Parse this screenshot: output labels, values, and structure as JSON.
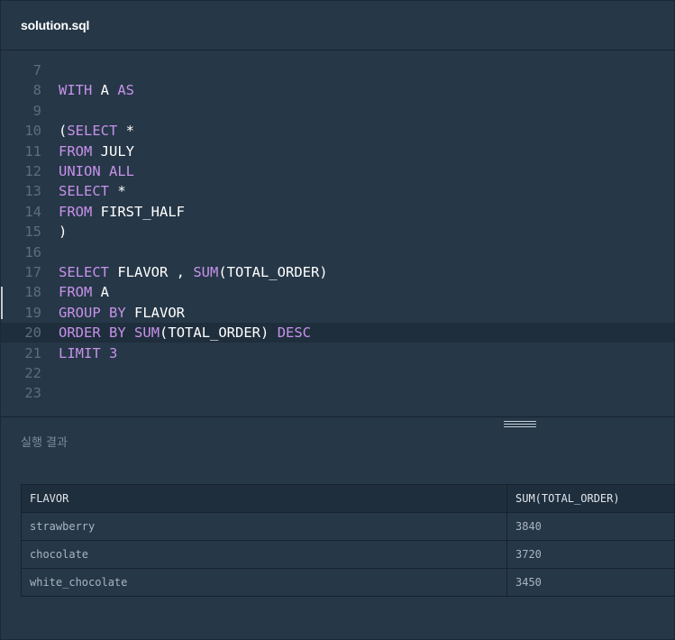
{
  "tab": {
    "title": "solution.sql"
  },
  "editor": {
    "lines": [
      {
        "n": "7",
        "tokens": []
      },
      {
        "n": "8",
        "tokens": [
          [
            "kw",
            "WITH"
          ],
          [
            "t",
            " A "
          ],
          [
            "kw",
            "AS"
          ]
        ]
      },
      {
        "n": "9",
        "tokens": []
      },
      {
        "n": "10",
        "tokens": [
          [
            "t",
            "("
          ],
          [
            "kw",
            "SELECT"
          ],
          [
            "t",
            " *"
          ]
        ]
      },
      {
        "n": "11",
        "tokens": [
          [
            "kw",
            "FROM"
          ],
          [
            "t",
            " JULY"
          ]
        ]
      },
      {
        "n": "12",
        "tokens": [
          [
            "kw",
            "UNION"
          ],
          [
            "t",
            " "
          ],
          [
            "kw",
            "ALL"
          ]
        ]
      },
      {
        "n": "13",
        "tokens": [
          [
            "kw",
            "SELECT"
          ],
          [
            "t",
            " *"
          ]
        ]
      },
      {
        "n": "14",
        "tokens": [
          [
            "kw",
            "FROM"
          ],
          [
            "t",
            " FIRST_HALF"
          ]
        ]
      },
      {
        "n": "15",
        "tokens": [
          [
            "t",
            ")"
          ]
        ]
      },
      {
        "n": "16",
        "tokens": []
      },
      {
        "n": "17",
        "tokens": [
          [
            "kw",
            "SELECT"
          ],
          [
            "t",
            " FLAVOR , "
          ],
          [
            "kw",
            "SUM"
          ],
          [
            "t",
            "(TOTAL_ORDER)"
          ]
        ]
      },
      {
        "n": "18",
        "tokens": [
          [
            "kw",
            "FROM"
          ],
          [
            "t",
            " A"
          ]
        ]
      },
      {
        "n": "19",
        "tokens": [
          [
            "kw",
            "GROUP"
          ],
          [
            "t",
            " "
          ],
          [
            "kw",
            "BY"
          ],
          [
            "t",
            " FLAVOR"
          ]
        ]
      },
      {
        "n": "20",
        "tokens": [
          [
            "kw",
            "ORDER"
          ],
          [
            "t",
            " "
          ],
          [
            "kw",
            "BY"
          ],
          [
            "t",
            " "
          ],
          [
            "kw",
            "SUM"
          ],
          [
            "t",
            "(TOTAL_ORDER) "
          ],
          [
            "kw",
            "DESC"
          ]
        ],
        "active": true
      },
      {
        "n": "21",
        "tokens": [
          [
            "kw",
            "LIMIT"
          ],
          [
            "t",
            " "
          ],
          [
            "num",
            "3"
          ]
        ]
      },
      {
        "n": "22",
        "tokens": []
      },
      {
        "n": "23",
        "tokens": []
      }
    ]
  },
  "results": {
    "title": "실행 결과",
    "columns": [
      "FLAVOR",
      "SUM(TOTAL_ORDER)"
    ],
    "rows": [
      [
        "strawberry",
        "3840"
      ],
      [
        "chocolate",
        "3720"
      ],
      [
        "white_chocolate",
        "3450"
      ]
    ]
  },
  "colors": {
    "background": "#263747",
    "keyword": "#c792ea",
    "text": "#ffffff",
    "gutter": "#5b6e80",
    "activeLine": "#1f2e3c"
  },
  "icons": {
    "resize_handle": "drag-handle-icon"
  }
}
